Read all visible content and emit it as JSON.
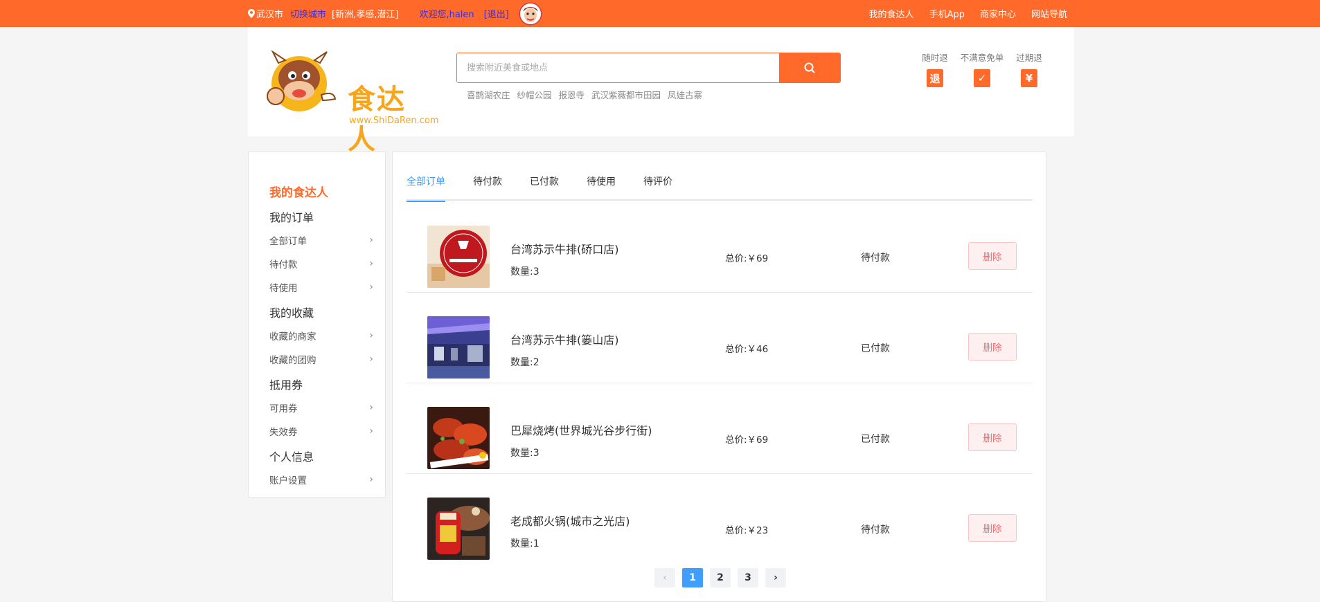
{
  "topbar": {
    "location": "武汉市",
    "switch_city": "切换城市",
    "nearby_cities": "[新洲,孝感,潜江]",
    "welcome": "欢迎您,halen",
    "logout": "[退出]",
    "links": [
      "我的食达人",
      "手机App",
      "商家中心",
      "网站导航"
    ],
    "color": "#ff6a2b"
  },
  "header": {
    "logo_text": "食达人",
    "logo_url": "www.ShiDaRen.com",
    "search_placeholder": "搜索附近美食或地点",
    "hot_keywords": [
      "喜鹊湖农庄",
      "纱帽公园",
      "报恩寺",
      "武汉紫薇都市田园",
      "凤娃古寨"
    ],
    "guarantees": [
      {
        "label": "随时退",
        "icon_char": "退",
        "icon": "refund-icon"
      },
      {
        "label": "不满意免单",
        "icon_char": "✓",
        "icon": "check-icon"
      },
      {
        "label": "过期退",
        "icon_char": "¥",
        "icon": "yuan-icon"
      }
    ]
  },
  "sidebar": {
    "title": "我的食达人",
    "groups": [
      {
        "label": "我的订单",
        "items": [
          "全部订单",
          "待付款",
          "待使用"
        ]
      },
      {
        "label": "我的收藏",
        "items": [
          "收藏的商家",
          "收藏的团购"
        ]
      },
      {
        "label": "抵用券",
        "items": [
          "可用券",
          "失效券"
        ]
      },
      {
        "label": "个人信息",
        "items": [
          "账户设置"
        ]
      }
    ]
  },
  "tabs": [
    "全部订单",
    "待付款",
    "已付款",
    "待使用",
    "待评价"
  ],
  "orders": [
    {
      "name": "台湾苏示牛排(硚口店)",
      "qty": "数量:3",
      "price": "总价:￥69",
      "status": "待付款",
      "action": "删除"
    },
    {
      "name": "台湾苏示牛排(篓山店)",
      "qty": "数量:2",
      "price": "总价:￥46",
      "status": "已付款",
      "action": "删除"
    },
    {
      "name": "巴犀烧烤(世界城光谷步行街)",
      "qty": "数量:3",
      "price": "总价:￥69",
      "status": "已付款",
      "action": "删除"
    },
    {
      "name": "老成都火锅(城市之光店)",
      "qty": "数量:1",
      "price": "总价:￥23",
      "status": "待付款",
      "action": "删除"
    }
  ],
  "pagination": {
    "prev": "‹",
    "pages": [
      "1",
      "2",
      "3"
    ],
    "next": "›",
    "current": "1"
  },
  "colors": {
    "brand": "#ff6a2b",
    "link": "#409eff",
    "danger": "#f56c6c"
  }
}
